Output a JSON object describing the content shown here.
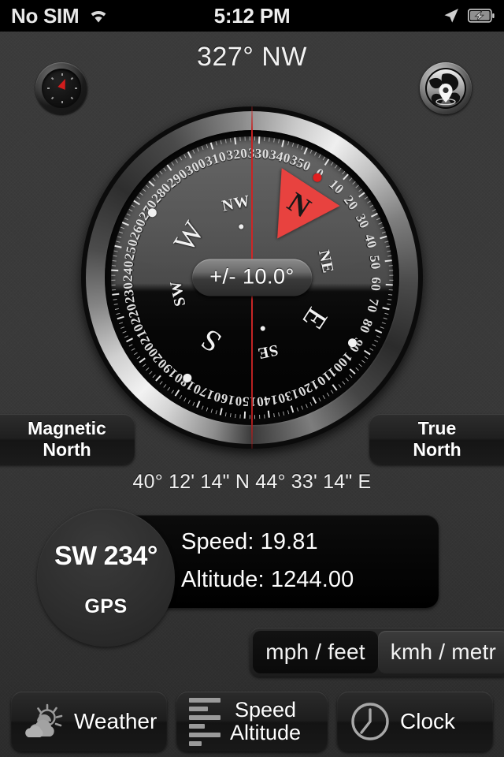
{
  "statusbar": {
    "carrier": "No SIM",
    "wifi_icon": "wifi-icon",
    "time": "5:12 PM",
    "location_icon": "location-arrow-icon",
    "battery_icon": "battery-charging-icon"
  },
  "header": {
    "heading": "327° NW",
    "left_button_icon": "mini-compass-icon",
    "right_button_icon": "globe-location-icon"
  },
  "compass": {
    "heading_degrees": 327,
    "heading_cardinal": "NW",
    "card_rotation": 33,
    "accuracy": "+/- 10.0°",
    "north_marker_label": "N",
    "degree_labels": [
      "0",
      "10",
      "20",
      "30",
      "40",
      "50",
      "60",
      "70",
      "80",
      "90",
      "100",
      "110",
      "120",
      "130",
      "140",
      "150",
      "160",
      "170",
      "180",
      "190",
      "200",
      "210",
      "220",
      "230",
      "240",
      "250",
      "260",
      "270",
      "280",
      "290",
      "300",
      "310",
      "320",
      "330",
      "340",
      "350"
    ],
    "cardinals": [
      {
        "label": "N",
        "deg": 0,
        "size": "hidden"
      },
      {
        "label": "NE",
        "deg": 45,
        "size": "secondary"
      },
      {
        "label": "E",
        "deg": 90,
        "size": "primary"
      },
      {
        "label": "SE",
        "deg": 135,
        "size": "secondary"
      },
      {
        "label": "S",
        "deg": 180,
        "size": "primary"
      },
      {
        "label": "SW",
        "deg": 225,
        "size": "secondary"
      },
      {
        "label": "W",
        "deg": 270,
        "size": "primary"
      },
      {
        "label": "NW",
        "deg": 315,
        "size": "secondary"
      }
    ],
    "accent_color": "#d02828",
    "north_marker_color": "#e8423f"
  },
  "north_mode": {
    "magnetic_line1": "Magnetic",
    "magnetic_line2": "North",
    "true_line1": "True",
    "true_line2": "North"
  },
  "location": {
    "coordinates": "40° 12' 14\" N  44° 33' 14\" E",
    "gps_heading": "SW 234°",
    "gps_label": "GPS",
    "speed": "Speed: 19.81",
    "altitude": "Altitude: 1244.00"
  },
  "units": {
    "imperial": "mph / feet",
    "metric": "kmh / metr",
    "selected": "metric"
  },
  "toolbar": {
    "weather_label": "Weather",
    "weather_icon": "sun-cloud-icon",
    "speed_line1": "Speed",
    "speed_line2": "Altitude",
    "speed_icon": "bar-levels-icon",
    "clock_label": "Clock",
    "clock_icon": "clock-icon"
  }
}
